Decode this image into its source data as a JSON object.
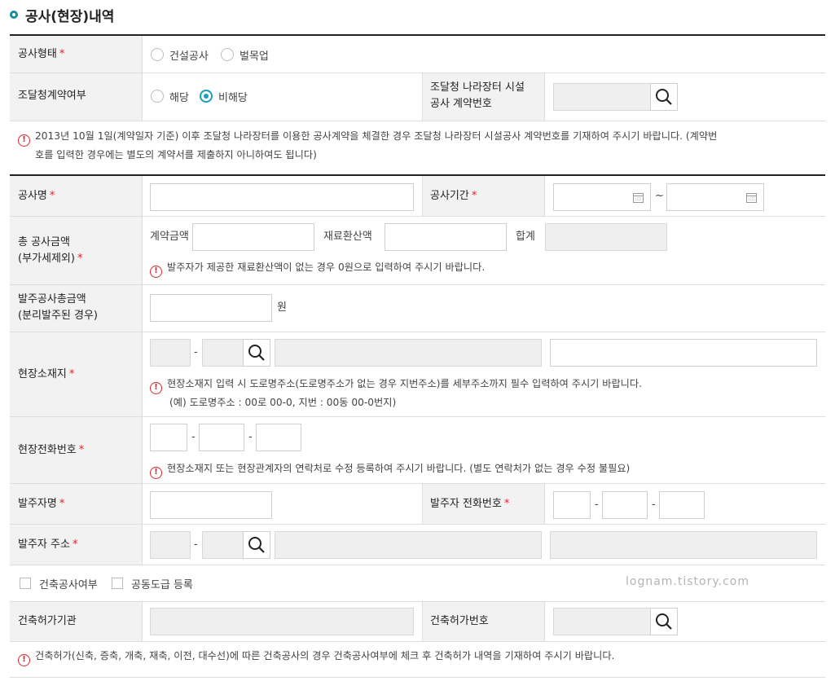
{
  "page_title": "공사(현장)내역",
  "construction_type": {
    "label": "공사형태",
    "options": [
      "건설공사",
      "벌목업"
    ]
  },
  "procurement_contract": {
    "label": "조달청계약여부",
    "options": [
      "해당",
      "비해당"
    ],
    "selected": "비해당"
  },
  "procurement_number": {
    "label_line1": "조달청 나라장터 시설",
    "label_line2": "공사 계약번호"
  },
  "notice_procurement": {
    "line1": "2013년 10월 1일(계약일자 기준) 이후 조달청 나라장터를 이용한 공사계약을 체결한 경우 조달청 나라장터 시설공사  계약번호를 기재하여 주시기 바랍니다. (계약번",
    "line2": "호를 입력한 경우에는 별도의 계약서를 제출하지 아니하여도 됩니다)"
  },
  "construction_name": {
    "label": "공사명"
  },
  "construction_period": {
    "label": "공사기간",
    "separator": "~"
  },
  "total_amount": {
    "label_line1": "총 공사금액",
    "label_line2": "(부가세제외)",
    "contract_label": "계약금액",
    "material_label": "재료환산액",
    "sum_label": "합계",
    "notice": "발주자가 제공한 재료환산액이 없는 경우 0원으로 입력하여 주시기 바랍니다."
  },
  "order_total": {
    "label_line1": "발주공사총금액",
    "label_line2": "(분리발주된 경우)",
    "unit": "원"
  },
  "site_address": {
    "label": "현장소재지",
    "dash": "-",
    "notice_line1": "현장소재지 입력 시 도로명주소(도로명주소가 없는 경우 지번주소)를 세부주소까지 필수 입력하여 주시기 바랍니다.",
    "notice_line2": "(예) 도로명주소 : 00로 00-0, 지번 : 00동 00-0번지)"
  },
  "site_phone": {
    "label": "현장전화번호",
    "dash": "-",
    "notice": "현장소재지 또는 현장관계자의 연락처로 수정 등록하여 주시기 바랍니다. (별도 연락처가 없는 경우 수정 불필요)"
  },
  "client_name": {
    "label": "발주자명"
  },
  "client_phone": {
    "label": "발주자 전화번호",
    "dash": "-"
  },
  "client_address": {
    "label": "발주자 주소",
    "dash": "-"
  },
  "checkboxes": {
    "building": "건축공사여부",
    "joint": "공동도급 등록"
  },
  "watermark": "lognam.tistory.com",
  "permit_agency": {
    "label": "건축허가기관"
  },
  "permit_number": {
    "label": "건축허가번호"
  },
  "notice_permit": "건축허가(신축, 증축, 개축, 재축, 이전, 대수선)에 따른 건축공사의 경우 건축공사여부에 체크 후 건축허가 내역을 기재하여 주시기 바랍니다.",
  "required_mark": "*",
  "warn_glyph": "!",
  "colors": {
    "accent": "#1a9ec0",
    "required": "#e0222c",
    "label_bg": "#f2f2f2"
  }
}
